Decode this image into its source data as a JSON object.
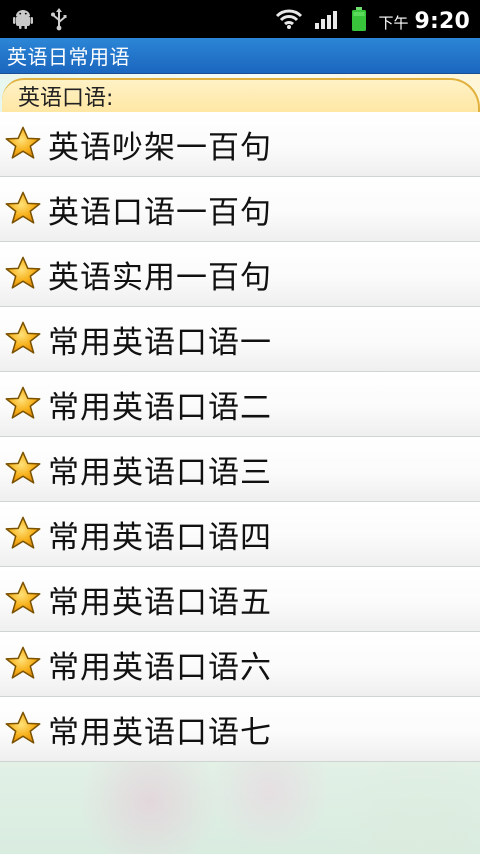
{
  "status_bar": {
    "time_prefix": "下午",
    "time": "9:20",
    "icons": [
      "android-debug-icon",
      "usb-icon",
      "wifi-icon",
      "signal-icon",
      "battery-icon"
    ],
    "battery_color": "#38c43b"
  },
  "app": {
    "title": "英语日常用语",
    "title_bar_color": "#1b66bf"
  },
  "section": {
    "label": "英语口语:",
    "tab_color": "#ffe7a4",
    "tab_border_color": "#e0b13e"
  },
  "list": {
    "items": [
      {
        "label": "英语吵架一百句",
        "icon": "star-icon"
      },
      {
        "label": "英语口语一百句",
        "icon": "star-icon"
      },
      {
        "label": "英语实用一百句",
        "icon": "star-icon"
      },
      {
        "label": "常用英语口语一",
        "icon": "star-icon"
      },
      {
        "label": "常用英语口语二",
        "icon": "star-icon"
      },
      {
        "label": "常用英语口语三",
        "icon": "star-icon"
      },
      {
        "label": "常用英语口语四",
        "icon": "star-icon"
      },
      {
        "label": "常用英语口语五",
        "icon": "star-icon"
      },
      {
        "label": "常用英语口语六",
        "icon": "star-icon"
      },
      {
        "label": "常用英语口语七",
        "icon": "star-icon"
      }
    ],
    "star_color": "#f7a412"
  }
}
